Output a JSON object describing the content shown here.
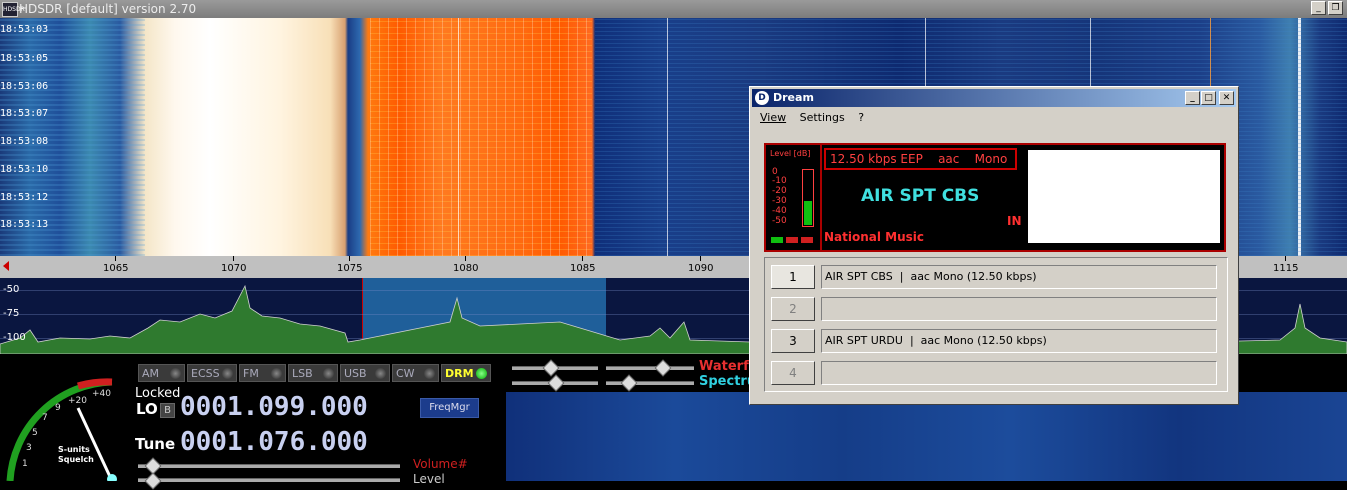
{
  "main_window": {
    "title": "HDSDR [default]  version 2.70",
    "app_icon_text": "HDSDR",
    "min_glyph": "_",
    "restore_glyph": "❐"
  },
  "waterfall": {
    "timestamps": [
      "18:53:03",
      "18:53:05",
      "18:53:06",
      "18:53:07",
      "18:53:08",
      "18:53:10",
      "18:53:12",
      "18:53:13"
    ]
  },
  "frequency_scale": {
    "labels": [
      "1065",
      "1070",
      "1075",
      "1080",
      "1085",
      "1090",
      "1115"
    ]
  },
  "spectrum": {
    "db_labels": [
      "-50",
      "-75",
      "-100"
    ]
  },
  "modes": [
    {
      "label": "AM",
      "active": false
    },
    {
      "label": "ECSS",
      "active": false
    },
    {
      "label": "FM",
      "active": false
    },
    {
      "label": "LSB",
      "active": false
    },
    {
      "label": "USB",
      "active": false
    },
    {
      "label": "CW",
      "active": false
    },
    {
      "label": "DRM",
      "active": true
    }
  ],
  "radio": {
    "locked_label": "Locked",
    "lo_label": "LO",
    "lo_b": "B",
    "lo_freq": "0001.099.000",
    "tune_label": "Tune",
    "tune_freq": "0001.076.000",
    "freqmgr_label": "FreqMgr",
    "volume_label": "Volume#",
    "level_label": "Level",
    "waterfall_label": "Waterfa",
    "spectrum_label": "Spectru"
  },
  "smeter": {
    "scale": [
      "1",
      "3",
      "5",
      "7",
      "9",
      "+20",
      "+40"
    ],
    "label_line1": "S-units",
    "label_line2": "Squelch"
  },
  "dream": {
    "title": "Dream",
    "logo": "D",
    "menu": [
      "View",
      "Settings",
      "?"
    ],
    "level_title": "Level [dB]",
    "level_ticks": [
      "0",
      "-10",
      "-20",
      "-30",
      "-40",
      "-50"
    ],
    "level_fraction": 0.43,
    "bitrate": "12.50 kbps EEP    aac    Mono",
    "station": "AIR SPT CBS",
    "country": "IN",
    "program_type": "National Music",
    "services": [
      {
        "number": "1",
        "label": "AIR SPT CBS  |  aac Mono (12.50 kbps)",
        "enabled": true
      },
      {
        "number": "2",
        "label": "",
        "enabled": false
      },
      {
        "number": "3",
        "label": "AIR SPT URDU  |  aac Mono (12.50 kbps)",
        "enabled": true
      },
      {
        "number": "4",
        "label": "",
        "enabled": false
      }
    ]
  },
  "colors": {
    "drm_active": "#ffff30",
    "station_name": "#40e0e0",
    "dream_red": "#ff3030",
    "level_green": "#10c010"
  }
}
